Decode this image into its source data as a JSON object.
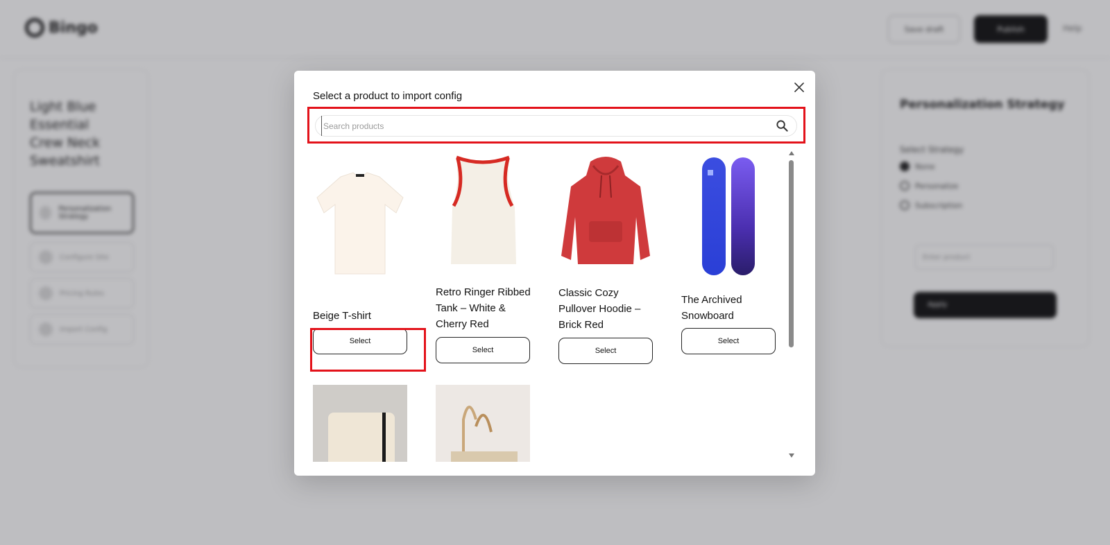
{
  "background": {
    "logo_text": "Bingo",
    "header_btn_outline": "Save draft",
    "header_btn_dark": "Publish",
    "header_link": "Help",
    "left_title": "Light Blue Essential Crew Neck Sweatshirt",
    "left_items": [
      {
        "label": "Personalization Strategy"
      },
      {
        "label": "Configure Site"
      },
      {
        "label": "Pricing Rules"
      },
      {
        "label": "Import Config"
      }
    ],
    "right_title": "Personalization Strategy",
    "right_sub": "Select Strategy",
    "right_radios": [
      "None",
      "Personalize",
      "Subscription"
    ],
    "right_field": "Enter product",
    "right_apply": "Apply"
  },
  "modal": {
    "title": "Select a product to import config",
    "search": {
      "placeholder": "Search products",
      "value": ""
    },
    "products": [
      {
        "name": "Beige T-shirt",
        "select_label": "Select",
        "image": "tshirt"
      },
      {
        "name": "Retro Ringer Ribbed Tank – White & Cherry Red",
        "select_label": "Select",
        "image": "tank"
      },
      {
        "name": "Classic Cozy Pullover Hoodie – Brick Red",
        "select_label": "Select",
        "image": "hoodie"
      },
      {
        "name": "The Archived Snowboard",
        "select_label": "Select",
        "image": "snowboard"
      },
      {
        "name": "",
        "select_label": "",
        "image": "notebook"
      },
      {
        "name": "",
        "select_label": "",
        "image": "tote"
      }
    ]
  },
  "colors": {
    "highlight": "#e3121a",
    "hoodie": "#cf3a3c",
    "tank_trim": "#d62a23",
    "snowboard": "#2a3fd6"
  },
  "icons": {
    "close": "close-icon",
    "search": "search-icon"
  }
}
